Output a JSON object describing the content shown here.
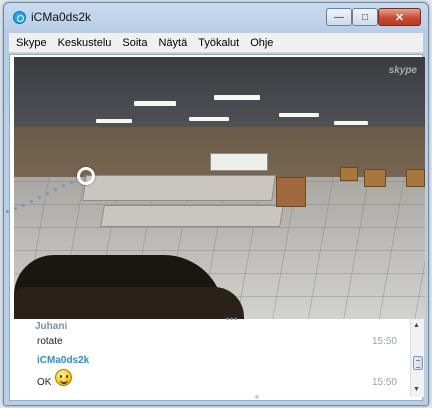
{
  "window": {
    "title": "iCMa0ds2k",
    "controls": {
      "minimize": "—",
      "maximize": "□",
      "close": "✕"
    }
  },
  "menu": [
    "Skype",
    "Keskustelu",
    "Soita",
    "Näytä",
    "Työkalut",
    "Ohje"
  ],
  "video": {
    "watermark": "skype"
  },
  "chat": {
    "messages": [
      {
        "sender": "Juhani",
        "text": "rotate",
        "time": "15:50"
      },
      {
        "sender": "iCMa0ds2k",
        "text": "OK",
        "emoji": "smiley",
        "time": "15:50"
      }
    ]
  },
  "icons": {
    "app": "skype-icon",
    "emoji": "smiley-icon"
  }
}
